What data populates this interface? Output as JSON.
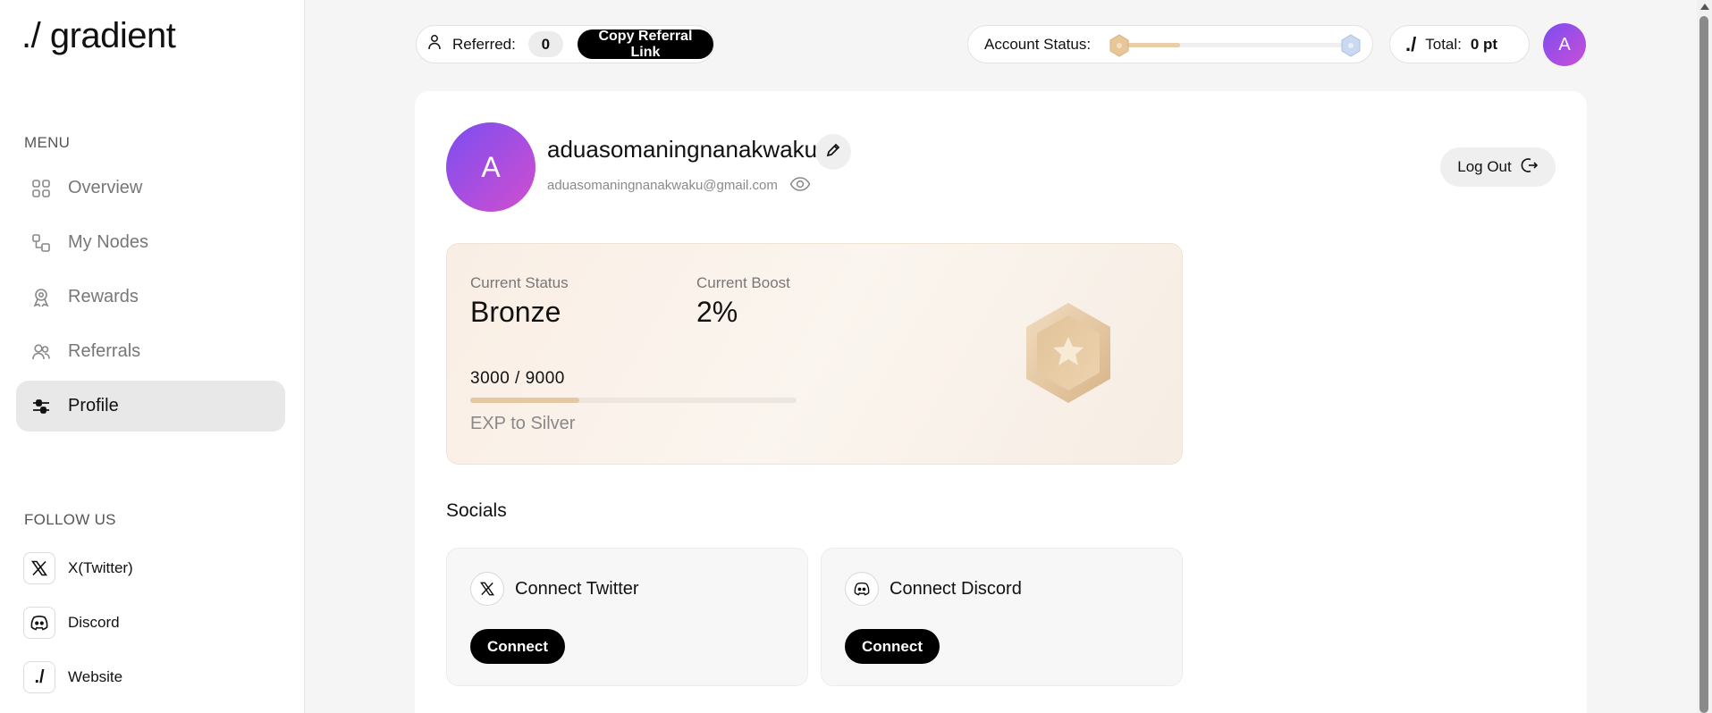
{
  "brand": {
    "logo": "./ gradient"
  },
  "sidebar": {
    "menu_title": "MENU",
    "items": [
      {
        "label": "Overview",
        "icon": "grid-icon"
      },
      {
        "label": "My Nodes",
        "icon": "nodes-icon"
      },
      {
        "label": "Rewards",
        "icon": "award-icon"
      },
      {
        "label": "Referrals",
        "icon": "users-icon"
      },
      {
        "label": "Profile",
        "icon": "sliders-icon",
        "active": true
      }
    ],
    "follow_title": "FOLLOW US",
    "socials": [
      {
        "label": "X(Twitter)",
        "icon": "x-logo-icon"
      },
      {
        "label": "Discord",
        "icon": "discord-icon"
      },
      {
        "label": "Website",
        "icon": "gradient-logo-icon",
        "glyph": "./"
      }
    ]
  },
  "topbar": {
    "referred_label": "Referred:",
    "referred_count": "0",
    "copy_link_label": "Copy Referral Link",
    "account_status_label": "Account Status:",
    "account_status_progress": 0.27,
    "total_glyph": "./",
    "total_label": "Total:",
    "total_value": "0 pt",
    "avatar_initial": "A"
  },
  "profile": {
    "avatar_initial": "A",
    "username": "aduasomaningnanakwaku",
    "email": "aduasomaningnanakwaku@gmail.com",
    "logout_label": "Log Out"
  },
  "status": {
    "current_status_label": "Current Status",
    "current_status_value": "Bronze",
    "current_boost_label": "Current Boost",
    "current_boost_value": "2%",
    "exp_text": "3000 / 9000",
    "exp_progress": 0.333,
    "exp_sub": "EXP to Silver"
  },
  "socials": {
    "title": "Socials",
    "cards": [
      {
        "label": "Connect Twitter",
        "button": "Connect",
        "icon": "x-logo-icon"
      },
      {
        "label": "Connect Discord",
        "button": "Connect",
        "icon": "discord-icon"
      }
    ]
  },
  "colors": {
    "accent_gradient_start": "#7b4df0",
    "accent_gradient_end": "#d24fd0",
    "bronze": "#e3c8a0",
    "silver": "#b9cde6"
  }
}
